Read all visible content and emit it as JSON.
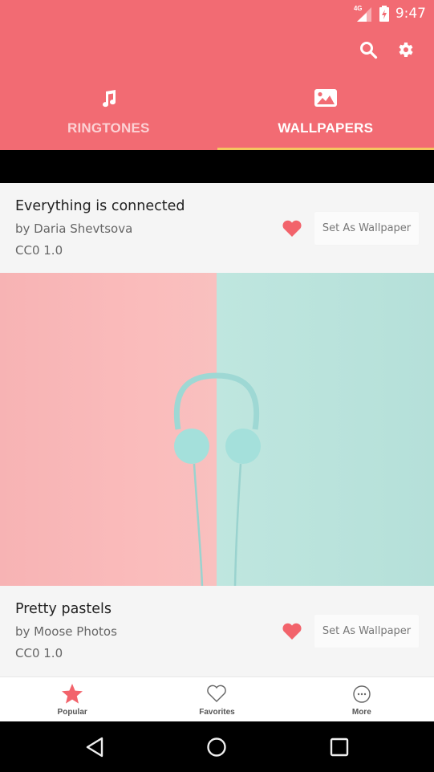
{
  "status_bar": {
    "network": "4G",
    "time": "9:47",
    "icons": [
      "signal-icon",
      "battery-charging-icon"
    ]
  },
  "toolbar": {
    "actions": [
      {
        "name": "search",
        "icon": "search-icon"
      },
      {
        "name": "settings",
        "icon": "gear-icon"
      }
    ]
  },
  "tabs": [
    {
      "label": "RINGTONES",
      "icon": "music-note-icon",
      "active": false
    },
    {
      "label": "WALLPAPERS",
      "icon": "image-icon",
      "active": true
    }
  ],
  "wallpapers": [
    {
      "title": "Everything is connected",
      "author": "by Daria Shevtsova",
      "license": "CC0 1.0",
      "favorited": true,
      "action_label": "Set As Wallpaper"
    },
    {
      "title": "Pretty pastels",
      "author": "by Moose Photos",
      "license": "CC0 1.0",
      "favorited": true,
      "action_label": "Set As Wallpaper"
    }
  ],
  "bottom_nav": [
    {
      "label": "Popular",
      "icon": "star-icon",
      "active": true
    },
    {
      "label": "Favorites",
      "icon": "heart-outline-icon",
      "active": false
    },
    {
      "label": "More",
      "icon": "more-circle-icon",
      "active": false
    }
  ],
  "colors": {
    "primary": "#f26b73",
    "tab_indicator": "#f5c560",
    "heart": "#f2636b",
    "star_active": "#f2636b"
  }
}
